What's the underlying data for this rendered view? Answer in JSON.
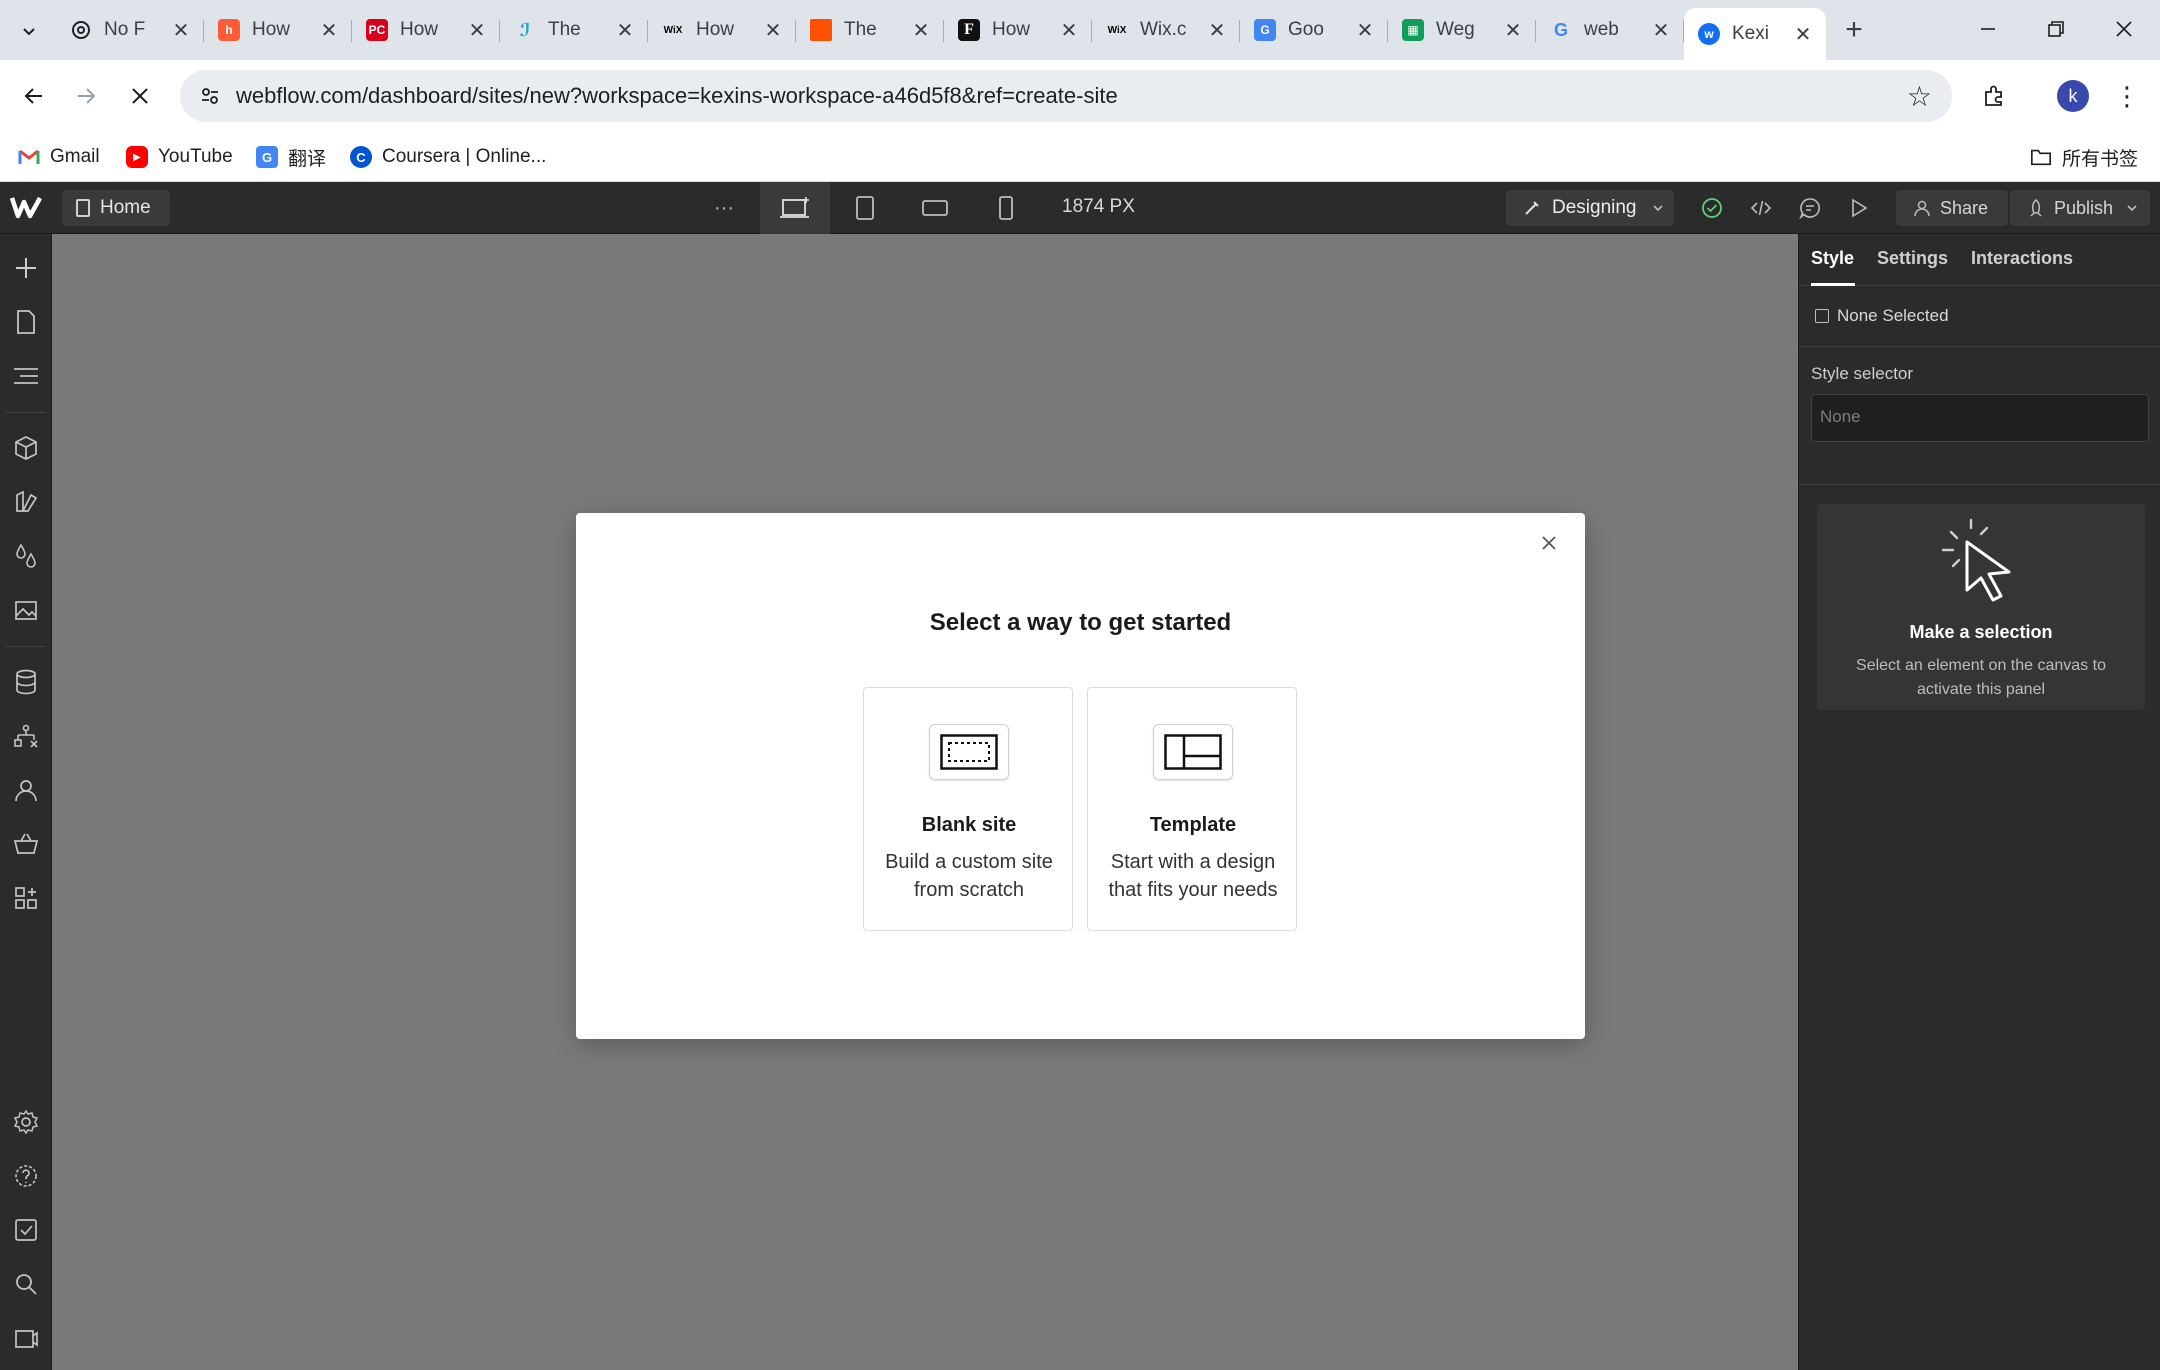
{
  "browser": {
    "tabs": [
      {
        "title": "No F",
        "favicon": "openai-icon",
        "fav_color": "#1f1f1f"
      },
      {
        "title": "How",
        "favicon": "hubspot-icon",
        "fav_color": "#ff5c35"
      },
      {
        "title": "How",
        "favicon": "pcmag-icon",
        "fav_color": "#d6001c"
      },
      {
        "title": "The",
        "favicon": "teal-logo-icon",
        "fav_color": "#1aa6c9"
      },
      {
        "title": "How",
        "favicon": "wix-icon",
        "fav_color": "#000000"
      },
      {
        "title": "The",
        "favicon": "orange-square-icon",
        "fav_color": "#ff4f00"
      },
      {
        "title": "How",
        "favicon": "forbes-icon",
        "fav_color": "#111111"
      },
      {
        "title": "Wix.c",
        "favicon": "wix-icon",
        "fav_color": "#000000"
      },
      {
        "title": "Goo",
        "favicon": "google-translate-icon",
        "fav_color": "#4285f4"
      },
      {
        "title": "Weg",
        "favicon": "google-sheets-icon",
        "fav_color": "#0f9d58"
      },
      {
        "title": "web",
        "favicon": "google-icon",
        "fav_color": "#4285f4"
      },
      {
        "title": "Kexi",
        "favicon": "webflow-icon",
        "fav_color": "#146ef5"
      }
    ],
    "url": "webflow.com/dashboard/sites/new?workspace=kexins-workspace-a46d5f8&ref=create-site",
    "profile_initial": "k",
    "bookmarks": [
      {
        "label": "Gmail",
        "icon": "gmail-icon"
      },
      {
        "label": "YouTube",
        "icon": "youtube-icon"
      },
      {
        "label": "翻译",
        "icon": "translate-icon"
      },
      {
        "label": "Coursera | Online...",
        "icon": "coursera-icon"
      }
    ],
    "all_bookmarks_label": "所有书签"
  },
  "designer": {
    "page_button": "Home",
    "canvas_width": "1874 PX",
    "mode": "Designing",
    "share_label": "Share",
    "publish_label": "Publish"
  },
  "right_panel": {
    "tabs": [
      "Style",
      "Settings",
      "Interactions"
    ],
    "active_tab": "Style",
    "none_selected": "None Selected",
    "style_selector_label": "Style selector",
    "style_selector_placeholder": "None",
    "empty_title": "Make a selection",
    "empty_desc": "Select an element on the canvas to activate this panel"
  },
  "modal": {
    "title": "Select a way to get started",
    "options": [
      {
        "name": "Blank site",
        "desc": "Build a custom site from scratch",
        "icon": "blank-page-icon"
      },
      {
        "name": "Template",
        "desc": "Start with a design that fits your needs",
        "icon": "template-layout-icon"
      }
    ]
  },
  "colors": {
    "designer_bg": "#2b2b2b",
    "canvas_bg": "#7a7a7a",
    "accent_blue": "#146ef5",
    "publish_check": "#5ed17a"
  }
}
